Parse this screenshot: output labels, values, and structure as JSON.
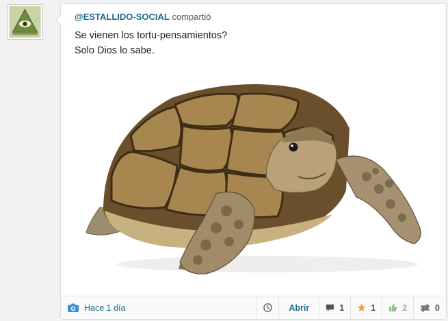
{
  "post": {
    "username": "@ESTALLIDO-SOCIAL",
    "action": "compartió",
    "text_lines": [
      "Se vienen los tortu-pensamientos?",
      "Solo Dios lo sabe."
    ]
  },
  "footer": {
    "camera_icon": "camera-icon",
    "time": "Hace 1 día",
    "open_label": "Abrir",
    "comments_count": "1",
    "favorites_count": "1",
    "likes_count": "2",
    "reshares_count": "0"
  },
  "colors": {
    "link": "#1d6a8a",
    "star": "#f0a030",
    "like": "#8cc48c",
    "background": "#f1f1f1"
  }
}
